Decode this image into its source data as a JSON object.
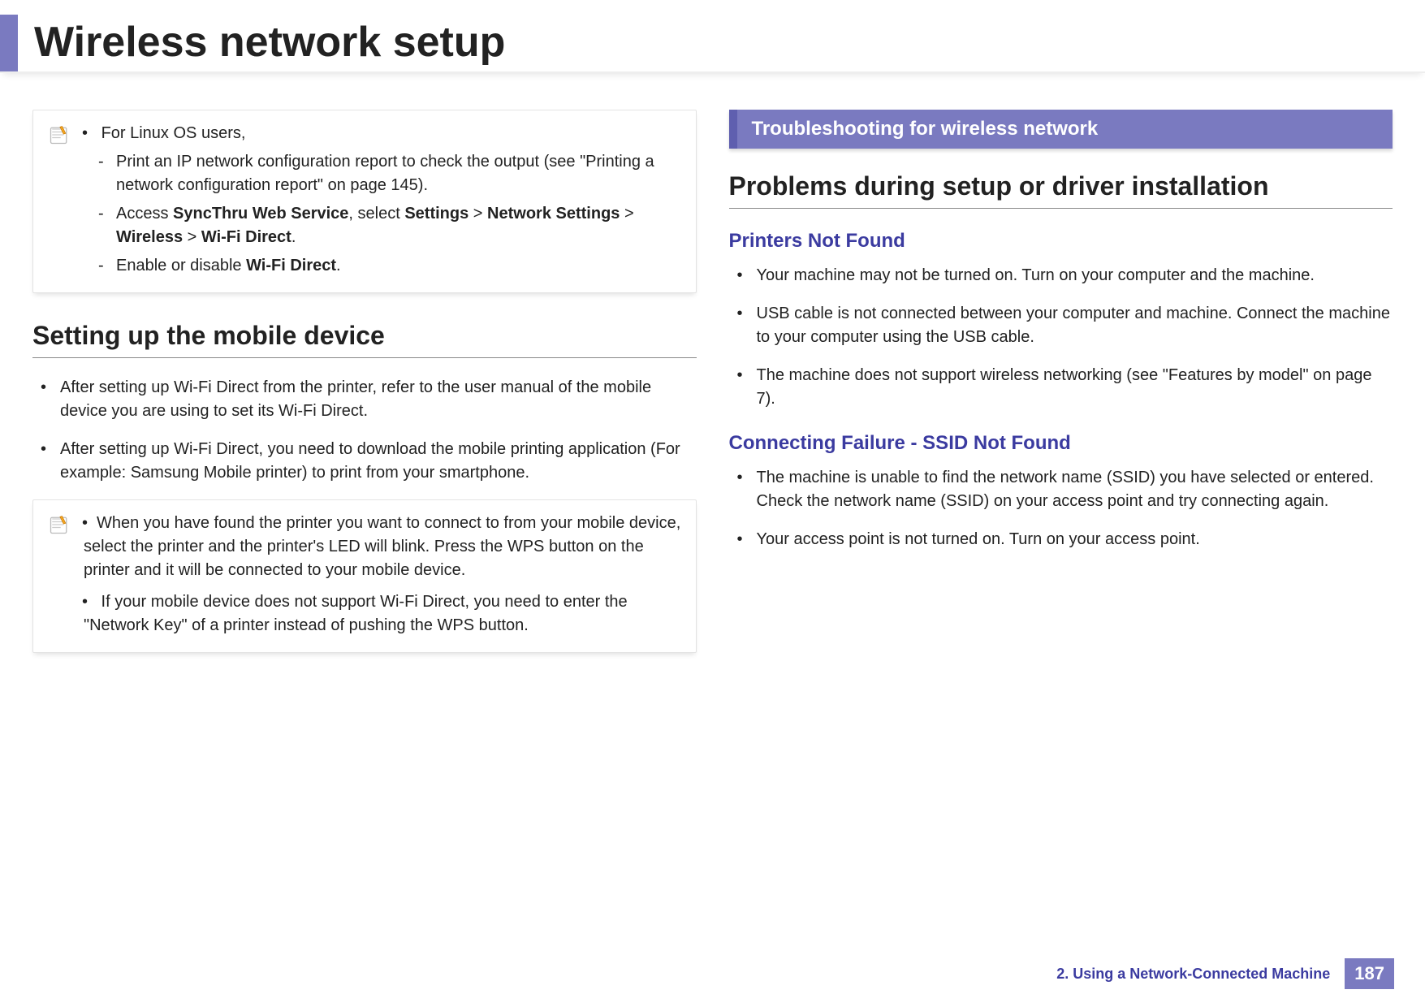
{
  "header": {
    "title": "Wireless network setup"
  },
  "left": {
    "note1": {
      "lead": "For Linux OS users,",
      "d1": "Print an IP network configuration report to check the output (see \"Printing a network configuration report\" on page 145).",
      "d2_pre": "Access ",
      "d2_b1": "SyncThru Web Service",
      "d2_mid1": ", select ",
      "d2_b2": "Settings",
      "d2_mid2": " > ",
      "d2_b3": "Network Settings",
      "d2_mid3": " > ",
      "d2_b4": "Wireless",
      "d2_mid4": " > ",
      "d2_b5": "Wi-Fi Direct",
      "d2_end": ".",
      "d3_pre": "Enable or disable ",
      "d3_b": "Wi-Fi Direct",
      "d3_end": "."
    },
    "h2": "Setting up the mobile device",
    "b1": "After setting up Wi-Fi Direct from the printer, refer to the user manual of the mobile device you are using to set its Wi-Fi Direct.",
    "b2": "After setting up Wi-Fi Direct, you need to download the mobile printing application (For example: Samsung Mobile printer) to print from your smartphone.",
    "note2": {
      "i1": "When you have found the printer you want to connect to from your mobile device, select the printer and the printer's LED will blink. Press the WPS button on the printer and it will be connected to your mobile device.",
      "i2": " If your mobile device does not support Wi-Fi Direct, you need to enter the \"Network Key\" of a printer instead of pushing the WPS button."
    }
  },
  "right": {
    "bar": "Troubleshooting for wireless network",
    "h2": "Problems during setup or driver installation",
    "h3a": "Printers Not Found",
    "a1": "Your machine may not be turned on. Turn on your computer and the machine.",
    "a2": "USB cable is not connected between your computer and machine. Connect the machine to your computer using the USB cable.",
    "a3": "The machine does not support wireless networking (see \"Features by model\" on page 7).",
    "h3b": "Connecting Failure - SSID Not Found",
    "b1": "The machine is unable to find the network name (SSID) you have selected or entered. Check the network name (SSID) on your access point and try connecting again.",
    "b2": "Your access point is not turned on. Turn on your access point."
  },
  "footer": {
    "chapter": "2.  Using a Network-Connected Machine",
    "page": "187"
  }
}
